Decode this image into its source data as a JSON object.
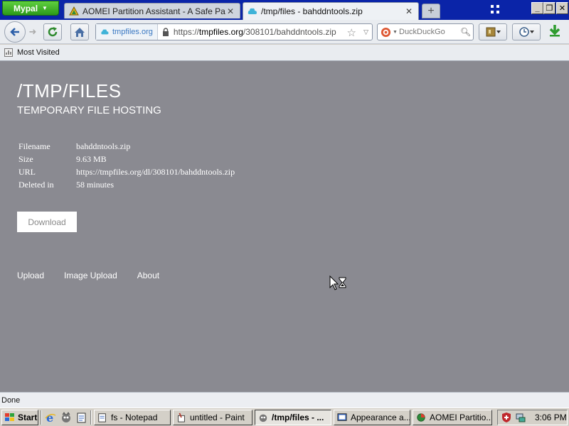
{
  "browser": {
    "menu_button": "Mypal",
    "tabs": [
      {
        "title": "AOMEI Partition Assistant - A Safe Partiti...",
        "icon": "aomei-icon",
        "active": false
      },
      {
        "title": "/tmp/files - bahddntools.zip",
        "icon": "cloud-icon",
        "active": true
      }
    ],
    "url": {
      "identity": "tmpfiles.org",
      "prefix": "https://",
      "host": "tmpfiles.org",
      "path": "/308101/bahddntools.zip"
    },
    "search_placeholder": "DuckDuckGo",
    "bookmarks": [
      {
        "label": "Most Visited"
      }
    ],
    "status": "Done"
  },
  "page": {
    "title": "/TMP/FILES",
    "subtitle": "TEMPORARY FILE HOSTING",
    "file_info": [
      {
        "label": "Filename",
        "value": "bahddntools.zip"
      },
      {
        "label": "Size",
        "value": "9.63 MB"
      },
      {
        "label": "URL",
        "value": "https://tmpfiles.org/dl/308101/bahddntools.zip"
      },
      {
        "label": "Deleted in",
        "value": "58 minutes"
      }
    ],
    "download_label": "Download",
    "footer_links": [
      "Upload",
      "Image Upload",
      "About"
    ]
  },
  "taskbar": {
    "start_label": "Start",
    "buttons": [
      {
        "label": "fs - Notepad",
        "icon": "notepad-icon",
        "active": false
      },
      {
        "label": "untitled - Paint",
        "icon": "paint-icon",
        "active": false
      },
      {
        "label": "/tmp/files - ...",
        "icon": "browser-icon",
        "active": true
      },
      {
        "label": "Appearance a...",
        "icon": "appearance-icon",
        "active": false
      },
      {
        "label": "AOMEI Partitio...",
        "icon": "aomei-icon",
        "active": false
      }
    ],
    "clock": "3:06 PM"
  },
  "colors": {
    "page_background": "#8a8a91",
    "titlebar": "#0a24a8",
    "menu_button": "#2c9a1a",
    "taskbar": "#d4d0c8"
  }
}
